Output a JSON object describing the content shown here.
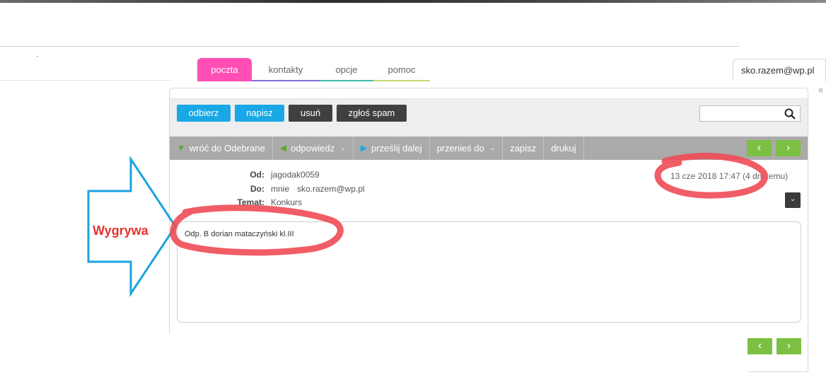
{
  "tabs": [
    {
      "label": "poczta"
    },
    {
      "label": "kontakty"
    },
    {
      "label": "opcje"
    },
    {
      "label": "pomoc"
    }
  ],
  "account": {
    "email": "sko.razem@wp.pl"
  },
  "toolbar": {
    "receive_label": "odbierz",
    "compose_label": "napisz",
    "delete_label": "usuń",
    "spam_label": "zgłoś spam",
    "search_placeholder": ""
  },
  "actions": {
    "back_label": "wróć do Odebrane",
    "reply_label": "odpowiedz",
    "forward_label": "prześlij dalej",
    "move_label": "przenieś do",
    "save_label": "zapisz",
    "print_label": "drukuj"
  },
  "message": {
    "from_label": "Od:",
    "from_value": "jagodak0059",
    "to_label": "Do:",
    "to_name": "mnie",
    "to_email": "sko.razem@wp.pl",
    "subject_label": "Temat:",
    "subject_value": "Konkurs",
    "date": "13 cze 2018 17:47 (4 dni temu)",
    "body": "Odp. B dorian mataczyński kl.III"
  },
  "annotation": {
    "label": "Wygrywa",
    "color": "#e8322f",
    "arrow_color": "#1aa3e0",
    "highlight_color": "#f04b55"
  },
  "colors": {
    "tab_active": "#ff4fb4",
    "button_blue": "#19a8e5",
    "button_dark": "#404040",
    "nav_green": "#7bc043"
  }
}
